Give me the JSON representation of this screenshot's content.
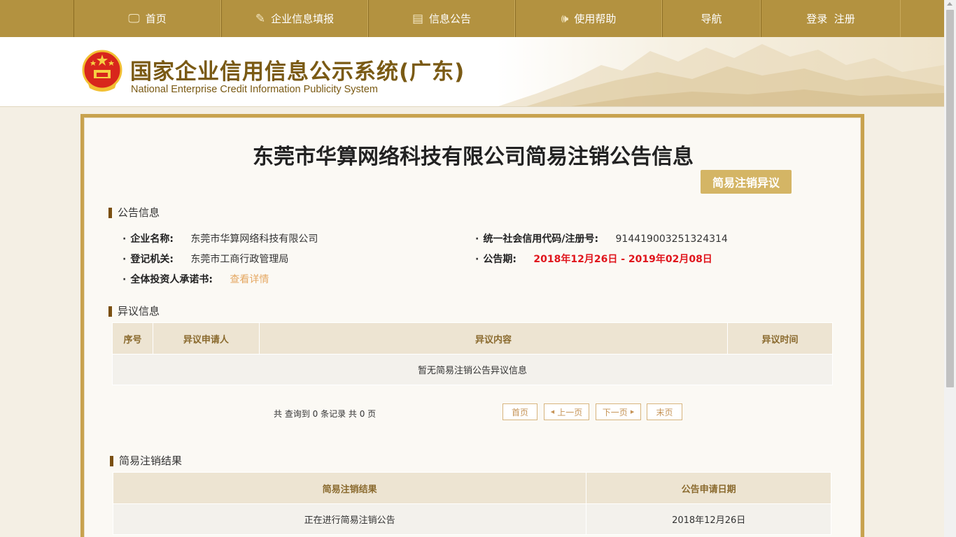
{
  "nav": [
    {
      "label": "首页",
      "icon": "monitor-icon",
      "glyph": "🖵"
    },
    {
      "label": "企业信息填报",
      "icon": "edit-icon",
      "glyph": "✎"
    },
    {
      "label": "信息公告",
      "icon": "document-icon",
      "glyph": "▤"
    },
    {
      "label": "使用帮助",
      "icon": "speaker-icon",
      "glyph": "🕪"
    },
    {
      "label": "导航",
      "icon": "",
      "glyph": ""
    },
    {
      "label": "登录  注册",
      "icon": "",
      "glyph": ""
    }
  ],
  "header": {
    "title": "国家企业信用信息公示系统(广东)",
    "subtitle": "National Enterprise Credit Information Publicity System"
  },
  "page_title": "东莞市华算网络科技有限公司简易注销公告信息",
  "objection_button": "简易注销异议",
  "notice": {
    "heading": "公告信息",
    "company_label": "企业名称:",
    "company_value": "东莞市华算网络科技有限公司",
    "credit_label": "统一社会信用代码/注册号:",
    "credit_value": "914419003251324314",
    "authority_label": "登记机关:",
    "authority_value": "东莞市工商行政管理局",
    "period_label": "公告期:",
    "period_value": "2018年12月26日 - 2019年02月08日",
    "commitment_label": "全体投资人承诺书:",
    "commitment_link": "查看详情"
  },
  "objection": {
    "heading": "异议信息",
    "columns": [
      "序号",
      "异议申请人",
      "异议内容",
      "异议时间"
    ],
    "empty_text": "暂无简易注销公告异议信息",
    "pager_info": "共 查询到 0 条记录 共 0 页",
    "pager": {
      "first": "首页",
      "prev": "上一页",
      "next": "下一页",
      "last": "末页"
    }
  },
  "result": {
    "heading": "简易注销结果",
    "columns": [
      "简易注销结果",
      "公告申请日期"
    ],
    "rows": [
      [
        "正在进行简易注销公告",
        "2018年12月26日"
      ]
    ]
  }
}
